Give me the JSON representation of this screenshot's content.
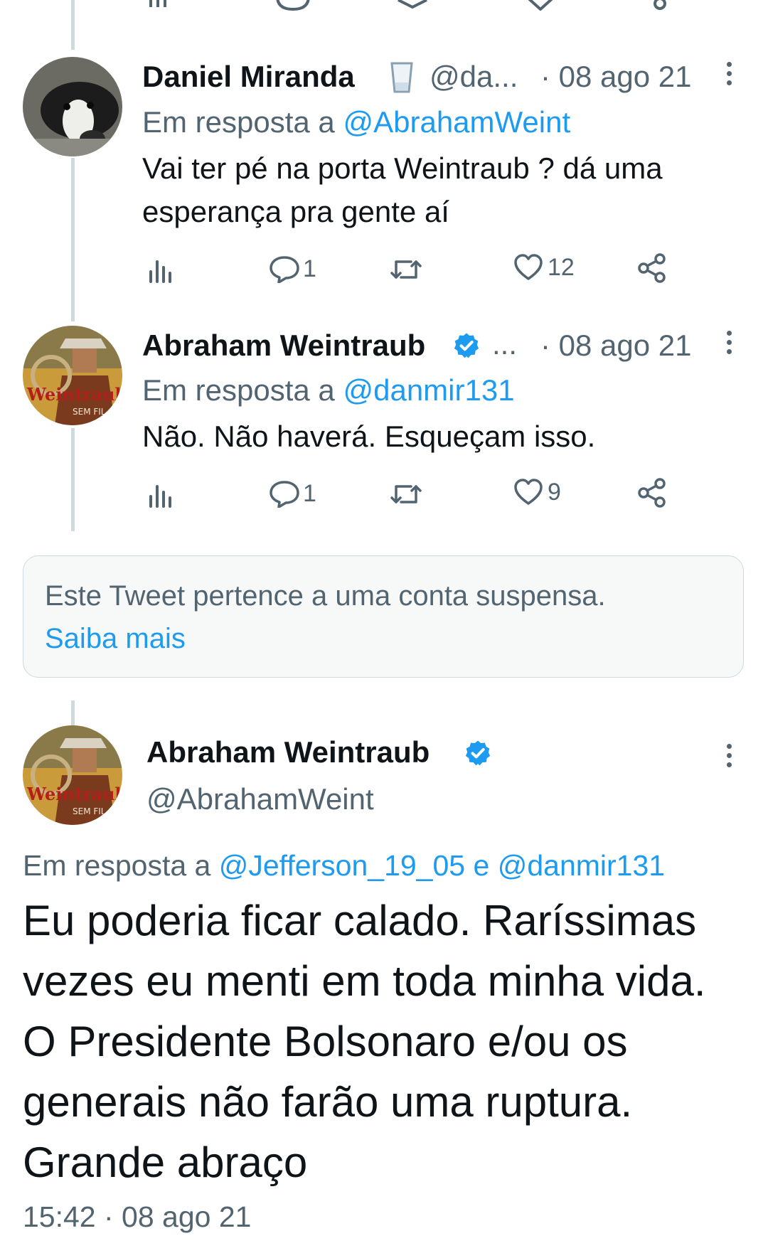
{
  "colors": {
    "accent": "#1d9bf0",
    "text": "#0f1419",
    "muted": "#536471",
    "border": "#cfd9de"
  },
  "reply1": {
    "name": "Daniel Miranda",
    "emoji_icon": "cup-icon",
    "handle": "@da...",
    "time": "· 08 ago 21",
    "reply_prefix": "Em resposta a",
    "reply_to": "@AbrahamWeint",
    "text": "Vai ter pé na porta Weintraub ? dá uma esperança pra gente aí",
    "replies": "1",
    "likes": "12"
  },
  "reply2": {
    "name": "Abraham Weintraub",
    "handle": "...",
    "time": "· 08 ago 21",
    "reply_prefix": "Em resposta a",
    "reply_to": "@danmir131",
    "text": "Não. Não haverá. Esqueçam isso.",
    "replies": "1",
    "likes": "9"
  },
  "suspended_notice": {
    "text": "Este Tweet pertence a uma conta suspensa.",
    "link": "Saiba mais"
  },
  "main_tweet": {
    "name": "Abraham Weintraub",
    "handle": "@AbrahamWeint",
    "reply_prefix": "Em resposta a",
    "reply_to_1": "@Jefferson_19_05",
    "reply_conj": "e",
    "reply_to_2": "@danmir131",
    "text": "Eu poderia ficar calado. Raríssimas vezes eu menti em toda minha vida. O Presidente Bolsonaro e/ou os generais não farão uma ruptura. Grande abraço",
    "timestamp": "15:42 · 08 ago 21"
  }
}
